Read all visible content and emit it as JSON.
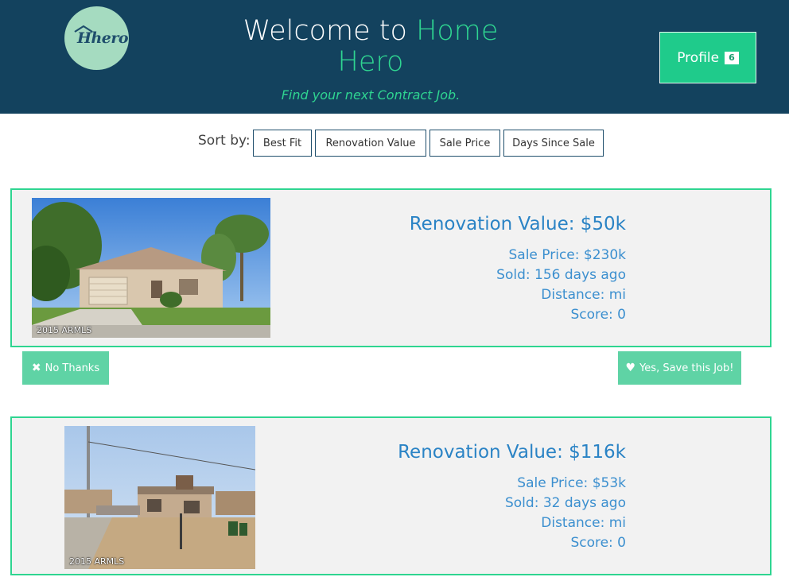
{
  "header": {
    "logo_text": "Hhero",
    "title_prefix": "Welcome to ",
    "title_accent": "Home Hero",
    "tagline": "Find your next Contract Job.",
    "profile_label": "Profile",
    "profile_count": "6"
  },
  "sort": {
    "label": "Sort by:",
    "options": [
      "Best Fit",
      "Renovation Value",
      "Sale Price",
      "Days Since Sale"
    ]
  },
  "listings": [
    {
      "photo_caption": "2015 ARMLS",
      "renovation": "Renovation Value: $50k",
      "sale_price": "Sale Price: $230k",
      "sold": "Sold: 156 days ago",
      "distance": "Distance: mi",
      "score": "Score: 0"
    },
    {
      "photo_caption": "2015 ARMLS",
      "renovation": "Renovation Value: $116k",
      "sale_price": "Sale Price: $53k",
      "sold": "Sold: 32 days ago",
      "distance": "Distance: mi",
      "score": "Score: 0"
    }
  ],
  "actions": {
    "no_label": "No Thanks",
    "no_icon": "times-icon",
    "yes_label": "Yes, Save this Job!",
    "yes_icon": "heart-icon"
  },
  "colors": {
    "header_bg": "#13425e",
    "accent_green": "#2fd591",
    "profile_green": "#1fcb8b",
    "action_green": "#5fd3a5",
    "link_blue": "#2a83c5"
  }
}
